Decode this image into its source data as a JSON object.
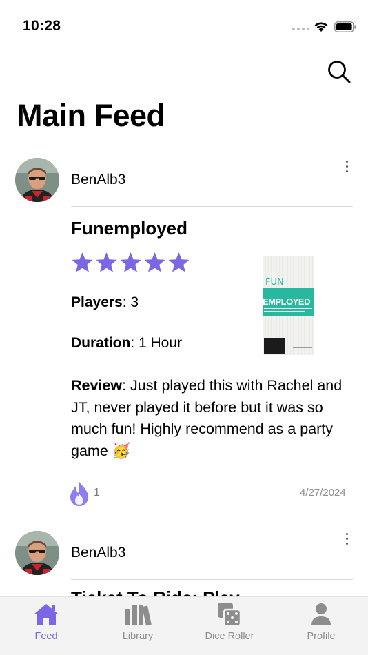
{
  "status_bar": {
    "time": "10:28"
  },
  "header": {
    "title": "Main Feed",
    "search_icon": "magnifying-glass-icon"
  },
  "colors": {
    "accent": "#7b66e6",
    "tab_inactive": "#8d8d8d",
    "divider": "#d8d8d8"
  },
  "posts": [
    {
      "username": "BenAlb3",
      "game_title": "Funemployed",
      "rating": 5,
      "players_label": "Players",
      "players_value": ": 3",
      "duration_label": "Duration",
      "duration_value": ": 1 Hour",
      "review_label": "Review",
      "review_text": ": Just played this with Rachel and JT, never played it before but it was so much fun! Highly recommend as a party game 🥳",
      "box_art_text_1": "FUN",
      "box_art_text_2": "EMPLOYED",
      "fire_count": "1",
      "date": "4/27/2024"
    },
    {
      "username": "BenAlb3",
      "game_title_peek": "Ticket To Ride: Play"
    }
  ],
  "tab_bar": {
    "tabs": [
      {
        "label": "Feed",
        "icon": "house-icon",
        "active": true
      },
      {
        "label": "Library",
        "icon": "books-icon",
        "active": false
      },
      {
        "label": "Dice Roller",
        "icon": "dice-icon",
        "active": false
      },
      {
        "label": "Profile",
        "icon": "person-icon",
        "active": false
      }
    ]
  }
}
